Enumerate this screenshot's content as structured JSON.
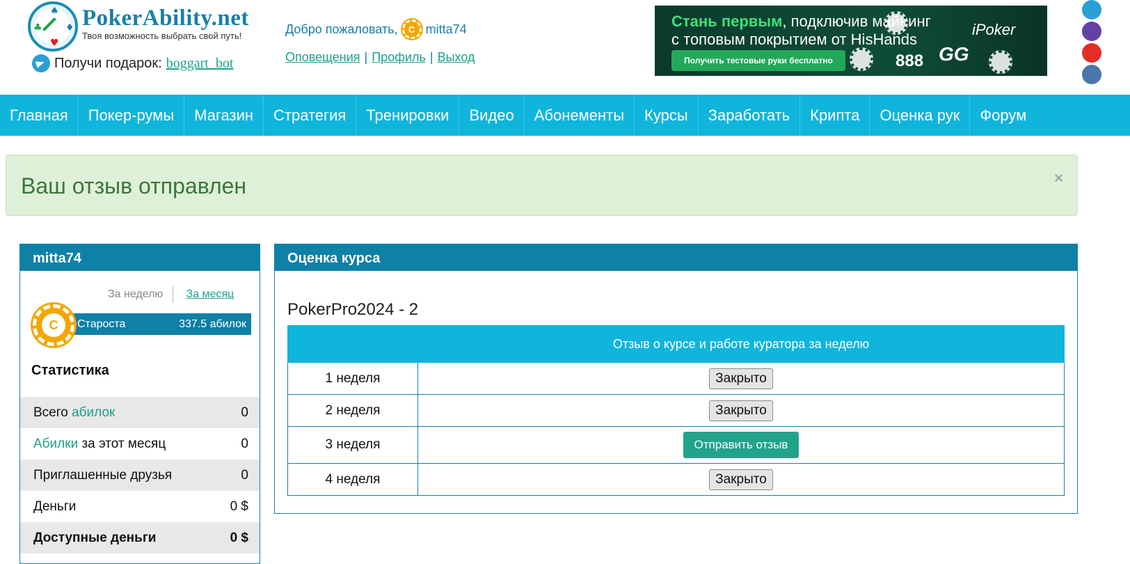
{
  "header": {
    "logo_title": "PokerAbility.net",
    "logo_subtitle": "Твоя возможность выбрать свой путь!",
    "gift_label": "Получи подарок:",
    "gift_link": "boggart_bot",
    "welcome": "Добро пожаловать,",
    "username": "mitta74",
    "links": {
      "notifications": "Оповещения",
      "profile": "Профиль",
      "logout": "Выход",
      "separator": "|"
    }
  },
  "banner": {
    "line1_highlight": "Стань первым",
    "line1_rest": ", подключив майнинг",
    "line2": "с топовым покрытием от HisHands",
    "button": "Получить тестовые руки бесплатно",
    "brand_ipoker": "iPoker",
    "brand_gg": "GG",
    "brand_888": "888"
  },
  "nav": {
    "items": [
      "Главная",
      "Покер-румы",
      "Магазин",
      "Стратегия",
      "Тренировки",
      "Видео",
      "Абонементы",
      "Курсы",
      "Заработать",
      "Крипта",
      "Оценка рук",
      "Форум"
    ]
  },
  "alert": {
    "message": "Ваш отзыв отправлен",
    "close": "×"
  },
  "sidebar": {
    "title": "mitta74",
    "period_week": "За неделю",
    "period_month": "За месяц",
    "coin_letter": "C",
    "rank": "Староста",
    "rank_value": "337.5 абилок",
    "stats_title": "Статистика",
    "stats": [
      {
        "pre": "Всего ",
        "hl": "абилок",
        "post": "",
        "value": "0"
      },
      {
        "pre": "",
        "hl": "Абилки",
        "post": " за этот месяц",
        "value": "0"
      },
      {
        "pre": "Приглашенные друзья",
        "hl": "",
        "post": "",
        "value": "0"
      },
      {
        "pre": "Деньги",
        "hl": "",
        "post": "",
        "value": "0 $"
      },
      {
        "pre": "Доступные деньги",
        "hl": "",
        "post": "",
        "value": "0 $"
      }
    ]
  },
  "main": {
    "title": "Оценка курса",
    "course": "PokerPro2024 - 2",
    "table": {
      "col1": "",
      "col2": "Отзыв о курсе и работе куратора за неделю",
      "rows": [
        {
          "week": "1 неделя",
          "action": "Закрыто"
        },
        {
          "week": "2 неделя",
          "action": "Закрыто"
        },
        {
          "week": "3 неделя",
          "action": "Отправить отзыв"
        },
        {
          "week": "4 неделя",
          "action": "Закрыто"
        }
      ]
    }
  },
  "colors": {
    "nav": "#10b5dc",
    "panel": "#0f80a6",
    "accent": "#1aa28a",
    "alert_bg": "#dff0d8",
    "alert_text": "#3c763d"
  }
}
